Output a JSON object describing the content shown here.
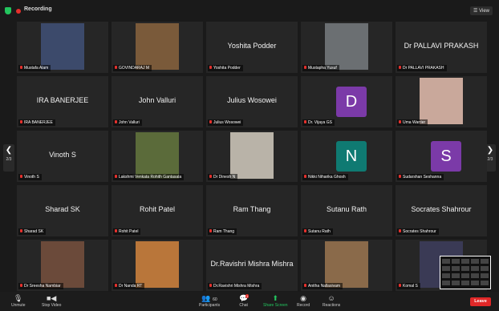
{
  "topbar": {
    "recording_label": "Recording",
    "view_label": "View"
  },
  "nav": {
    "left_page": "2/3",
    "right_page": "2/3",
    "left_arrow": "❮",
    "right_arrow": "❯"
  },
  "tiles": [
    {
      "label": "Mustafa Alam",
      "bigname": "",
      "avatar_letter": ""
    },
    {
      "label": "GOVINDARAJ M",
      "bigname": "",
      "avatar_letter": ""
    },
    {
      "label": "Yoshita Podder",
      "bigname": "Yoshita Podder",
      "avatar_letter": ""
    },
    {
      "label": "Mustapha Yusuf",
      "bigname": "",
      "avatar_letter": ""
    },
    {
      "label": "Dr PALLAVI PRAKASH",
      "bigname": "Dr PALLAVI PRAKASH",
      "avatar_letter": ""
    },
    {
      "label": "IRA BANERJEE",
      "bigname": "IRA BANERJEE",
      "avatar_letter": ""
    },
    {
      "label": "John Valluri",
      "bigname": "John Valluri",
      "avatar_letter": ""
    },
    {
      "label": "Julius Wosowei",
      "bigname": "Julius Wosowei",
      "avatar_letter": ""
    },
    {
      "label": "Dr. Vijaya GS",
      "bigname": "",
      "avatar_letter": "D",
      "avatar_color": "#7b3aa8"
    },
    {
      "label": "Uma Warrier",
      "bigname": "",
      "avatar_letter": ""
    },
    {
      "label": "Vinoth S",
      "bigname": "Vinoth S",
      "avatar_letter": ""
    },
    {
      "label": "Lakshmi Venkata Rohith Gantasala",
      "bigname": "",
      "avatar_letter": ""
    },
    {
      "label": "Dr Dinesh N",
      "bigname": "",
      "avatar_letter": ""
    },
    {
      "label": "Nikki Niharika Ghosh",
      "bigname": "",
      "avatar_letter": "N",
      "avatar_color": "#0f7a72"
    },
    {
      "label": "Sudarshan Seshanna",
      "bigname": "",
      "avatar_letter": "S",
      "avatar_color": "#7b3aa8"
    },
    {
      "label": "Sharad SK",
      "bigname": "Sharad SK",
      "avatar_letter": ""
    },
    {
      "label": "Rohit Patel",
      "bigname": "Rohit Patel",
      "avatar_letter": ""
    },
    {
      "label": "Ram Thang",
      "bigname": "Ram Thang",
      "avatar_letter": ""
    },
    {
      "label": "Sutanu Rath",
      "bigname": "Sutanu Rath",
      "avatar_letter": ""
    },
    {
      "label": "Socrates Shahrour",
      "bigname": "Socrates Shahrour",
      "avatar_letter": ""
    },
    {
      "label": "Dr Sreesha Nambiar",
      "bigname": "",
      "avatar_letter": ""
    },
    {
      "label": "Dr Nanda RT",
      "bigname": "",
      "avatar_letter": ""
    },
    {
      "label": "Dr.Ravishri Mishra Mishra",
      "bigname": "Dr.Ravishri Mishra Mishra",
      "avatar_letter": ""
    },
    {
      "label": "Anitha Nallasivam",
      "bigname": "",
      "avatar_letter": ""
    },
    {
      "label": "Komal S",
      "bigname": "",
      "avatar_letter": ""
    }
  ],
  "toolbar": {
    "unmute": "Unmute",
    "stop_video": "Stop Video",
    "participants": "Participants",
    "participants_count": "60",
    "chat": "Chat",
    "chat_badge": "1",
    "share_screen": "Share Screen",
    "record": "Record",
    "reactions": "Reactions",
    "leave": "Leave"
  }
}
